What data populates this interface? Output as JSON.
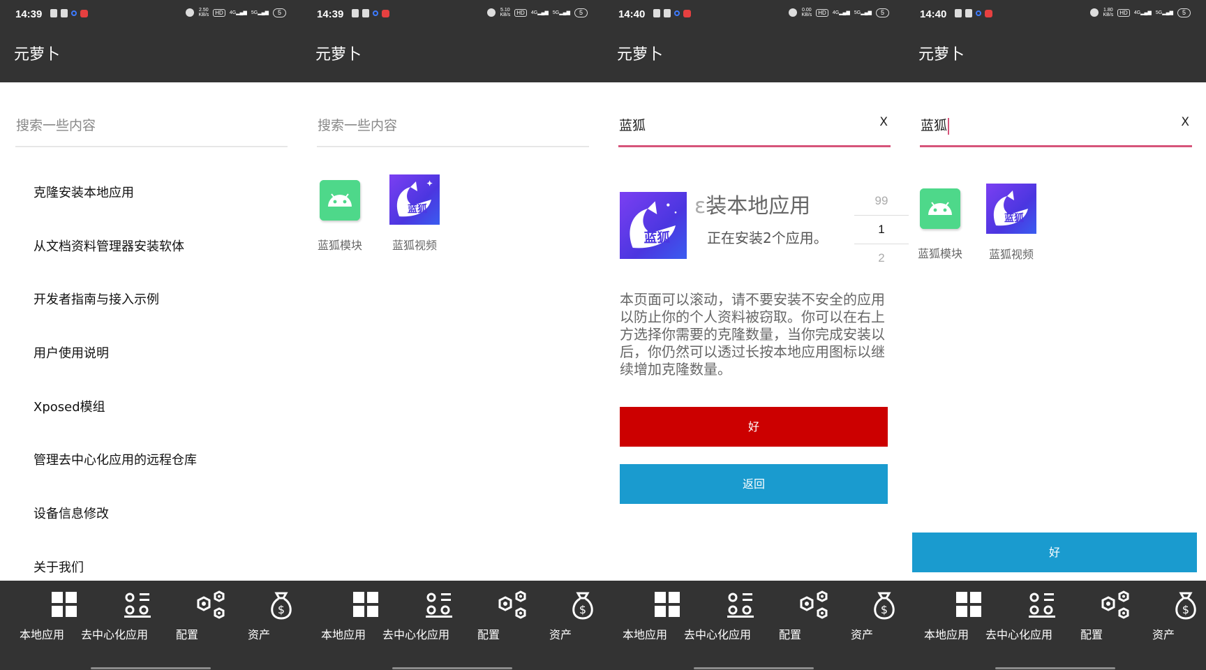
{
  "status": {
    "times": [
      "14:39",
      "14:39",
      "14:40",
      "14:40"
    ],
    "speeds": [
      "2.50",
      "5.10",
      "0.00",
      "1.80"
    ],
    "speed_unit": "KB/s",
    "battery": "5"
  },
  "app": {
    "title": "元萝卜"
  },
  "search": {
    "placeholder": "搜索一些内容",
    "query": "蓝狐",
    "clear_label": "X"
  },
  "menu": {
    "items": [
      "克隆安装本地应用",
      "从文档资料管理器安装软体",
      "开发者指南与接入示例",
      "用户使用说明",
      "Xposed模组",
      "管理去中心化应用的远程仓库",
      "设备信息修改",
      "关于我们"
    ]
  },
  "apps": [
    {
      "name": "蓝狐模块",
      "icon": "android-icon"
    },
    {
      "name": "蓝狐视频",
      "icon": "bluefox-icon"
    }
  ],
  "fox_logo_text": "蓝狐",
  "dialog": {
    "title": "装本地应用",
    "title_partial_char": "ɛ",
    "subtitle": "正在安装2个应用。",
    "picker": [
      "99",
      "1",
      "2"
    ],
    "body": "本页面可以滚动，请不要安装不安全的应用以防止你的个人资料被窃取。你可以在右上方选择你需要的克隆数量，当你完成安装以后，你仍然可以透过长按本地应用图标以继续增加克隆数量。",
    "ok_label": "好",
    "back_label": "返回"
  },
  "screen4": {
    "ok_label": "好"
  },
  "nav": {
    "items": [
      {
        "label": "本地应用",
        "icon": "grid-icon"
      },
      {
        "label": "去中心化应用",
        "icon": "decentral-icon"
      },
      {
        "label": "配置",
        "icon": "hexagon-settings-icon"
      },
      {
        "label": "资产",
        "icon": "money-bag-icon"
      }
    ]
  },
  "colors": {
    "bar": "#333333",
    "accent_pink": "#d6547a",
    "red_button": "#cc0000",
    "blue_button": "#1a9bcf"
  }
}
